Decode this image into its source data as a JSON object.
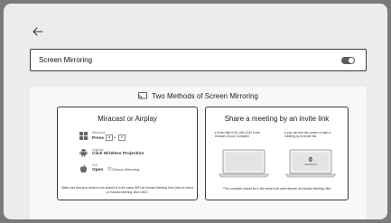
{
  "back": {
    "icon": "arrow-left-icon"
  },
  "setting": {
    "label": "Screen Mirroring",
    "toggle_on": true
  },
  "methods": {
    "title": "Two Methods of Screen Mirroring",
    "icon": "cast-icon",
    "left": {
      "title": "Miracast or Airplay",
      "windows": {
        "os": "Windows",
        "label": "Press",
        "keys": [
          "⊞",
          "K"
        ]
      },
      "android": {
        "os": "Android",
        "label": "Click Wireless Projection"
      },
      "ios": {
        "os": "iOS",
        "label": "Open",
        "extra": "Screen Mirroring"
      },
      "note": "Make sure that your device to be shared is in the same WiFi as Kandao Meeting Ultra (can be found on Kandao Meeting Ultra 1562 )"
    },
    "right": {
      "title": "Share a meeting by an invite link",
      "step1": "Enter http://101.168.3.242 in the browser of your Computer",
      "step2": "you can end the screen or start a meeting by an invite link",
      "screen_digit": "0",
      "note": "*The computer should be in the same local area network as Kandao Meeting  Ultra"
    }
  },
  "colors": {
    "background": "#7a7a7a",
    "panel": "#ececec",
    "toggle": "#5c5c5c"
  }
}
